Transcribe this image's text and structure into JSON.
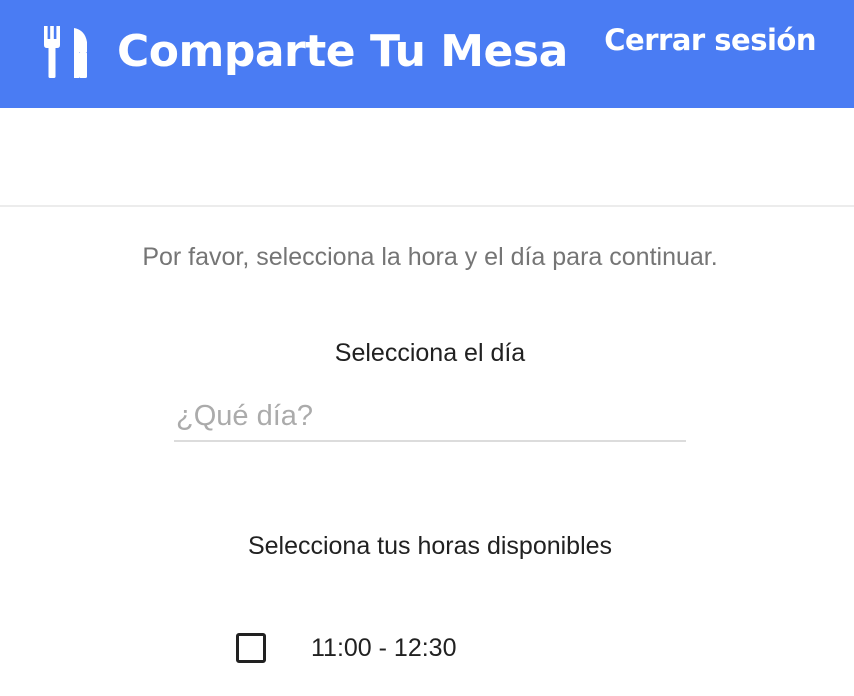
{
  "header": {
    "app_title": "Comparte Tu Mesa",
    "logout_label": "Cerrar sesión",
    "logo_icon": "fork-knife-icon",
    "brand_color": "#4a7cf3"
  },
  "main": {
    "instructions": "Por favor, selecciona la hora y el día para continuar.",
    "day_label": "Selecciona el día",
    "day_input": {
      "value": "",
      "placeholder": "¿Qué día?"
    },
    "hours_label": "Selecciona tus horas disponibles",
    "time_slots": [
      {
        "label": "11:00 - 12:30",
        "checked": false
      }
    ]
  }
}
